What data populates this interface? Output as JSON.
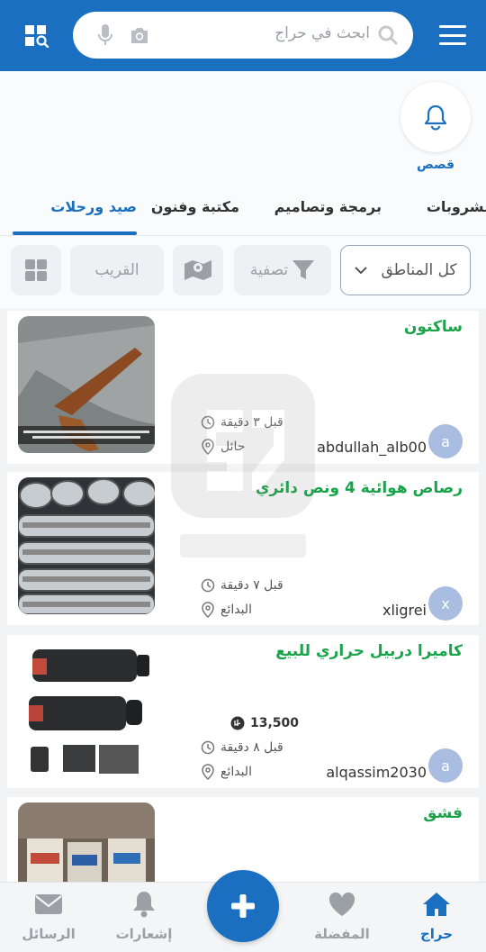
{
  "header": {
    "search_placeholder": "ابحث في حراج"
  },
  "stories": [
    {
      "label": "قصص"
    }
  ],
  "tabs": [
    {
      "label": "صيد ورحلات",
      "active": true
    },
    {
      "label": "مكتبة وفنون",
      "active": false
    },
    {
      "label": "برمجة وتصاميم",
      "active": false
    },
    {
      "label": "مشروبات",
      "active": false
    }
  ],
  "filters": {
    "region": "كل المناطق",
    "filter": "تصفية",
    "nearby": "القريب"
  },
  "listings": [
    {
      "title": "ساكتون",
      "time": "قبل ٣ دقيقة",
      "location": "حائل",
      "user": "abdullah_alb00",
      "avatar_letter": "a",
      "price": ""
    },
    {
      "title": "رصاص هوائية 4 ونص دائري",
      "time": "قبل ٧ دقيقة",
      "location": "البدائع",
      "user": "xligrei",
      "avatar_letter": "x",
      "price": ""
    },
    {
      "title": "كاميرا دربيل حراري للبيع",
      "time": "قبل ٨ دقيقة",
      "location": "البدائع",
      "user": "alqassim2030",
      "avatar_letter": "a",
      "price": "13,500"
    },
    {
      "title": "فشق",
      "time": "",
      "location": "",
      "user": "",
      "avatar_letter": "",
      "price": ""
    }
  ],
  "bottom_nav": {
    "home": "حراج",
    "favorites": "المفضلة",
    "notifications": "إشعارات",
    "messages": "الرسائل"
  },
  "colors": {
    "primary": "#1a6fc1",
    "title_green": "#1aa34a"
  }
}
